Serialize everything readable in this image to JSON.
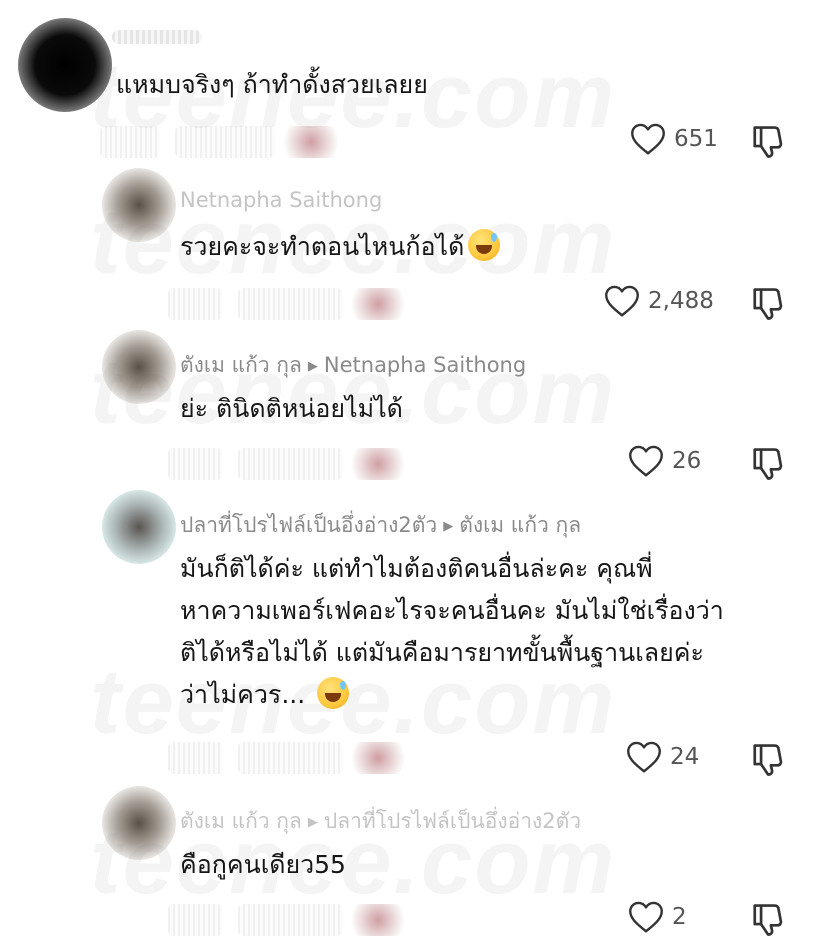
{
  "watermark": "teenee.com",
  "comments": [
    {
      "name": "",
      "reply_to": "",
      "text_lines": [
        "แหมบจริงๆ ถ้าทำดั้งสวยเลยย"
      ],
      "emoji": "",
      "likes": "651"
    },
    {
      "name": "Netnapha Saithong",
      "reply_to": "",
      "text_lines": [
        "รวยคะจะทำตอนไหนก้อได้"
      ],
      "emoji": "sweat-smile-emoji",
      "likes": "2,488"
    },
    {
      "name": "ตังเม แก้ว กุล",
      "reply_to": "Netnapha Saithong",
      "text_lines": [
        "ย่ะ ตินิดติหน่อยไม่ได้"
      ],
      "emoji": "",
      "likes": "26"
    },
    {
      "name": "ปลาที่โปรไฟล์เป็นอึ่งอ่าง2ตัว",
      "reply_to": "ตังเม แก้ว กุล",
      "text_lines": [
        "มันก็ติได้ค่ะ แต่ทำไมต้องติคนอื่นล่ะคะ คุณพี่",
        "หาความเพอร์เฟคอะไรจะคนอื่นคะ มันไม่ใช่เรื่องว่า",
        "ติได้หรือไม่ได้ แต่มันคือมารยาทขั้นพื้นฐานเลยค่ะ",
        "ว่าไม่ควร..."
      ],
      "emoji": "sweat-smile-emoji",
      "likes": "24"
    },
    {
      "name": "ตังเม แก้ว กุล",
      "reply_to": "ปลาที่โปรไฟล์เป็นอึ่งอ่าง2ตัว",
      "text_lines": [
        "คือกูคนเดียว55"
      ],
      "emoji": "",
      "likes": "2"
    }
  ],
  "icons": {
    "like": "heart-outline-icon",
    "dislike": "thumbs-down-outline-icon",
    "reply_arrow": "caret-right-icon"
  },
  "colors": {
    "text": "#161616",
    "meta": "#8a8a8a",
    "icon": "#333333"
  }
}
